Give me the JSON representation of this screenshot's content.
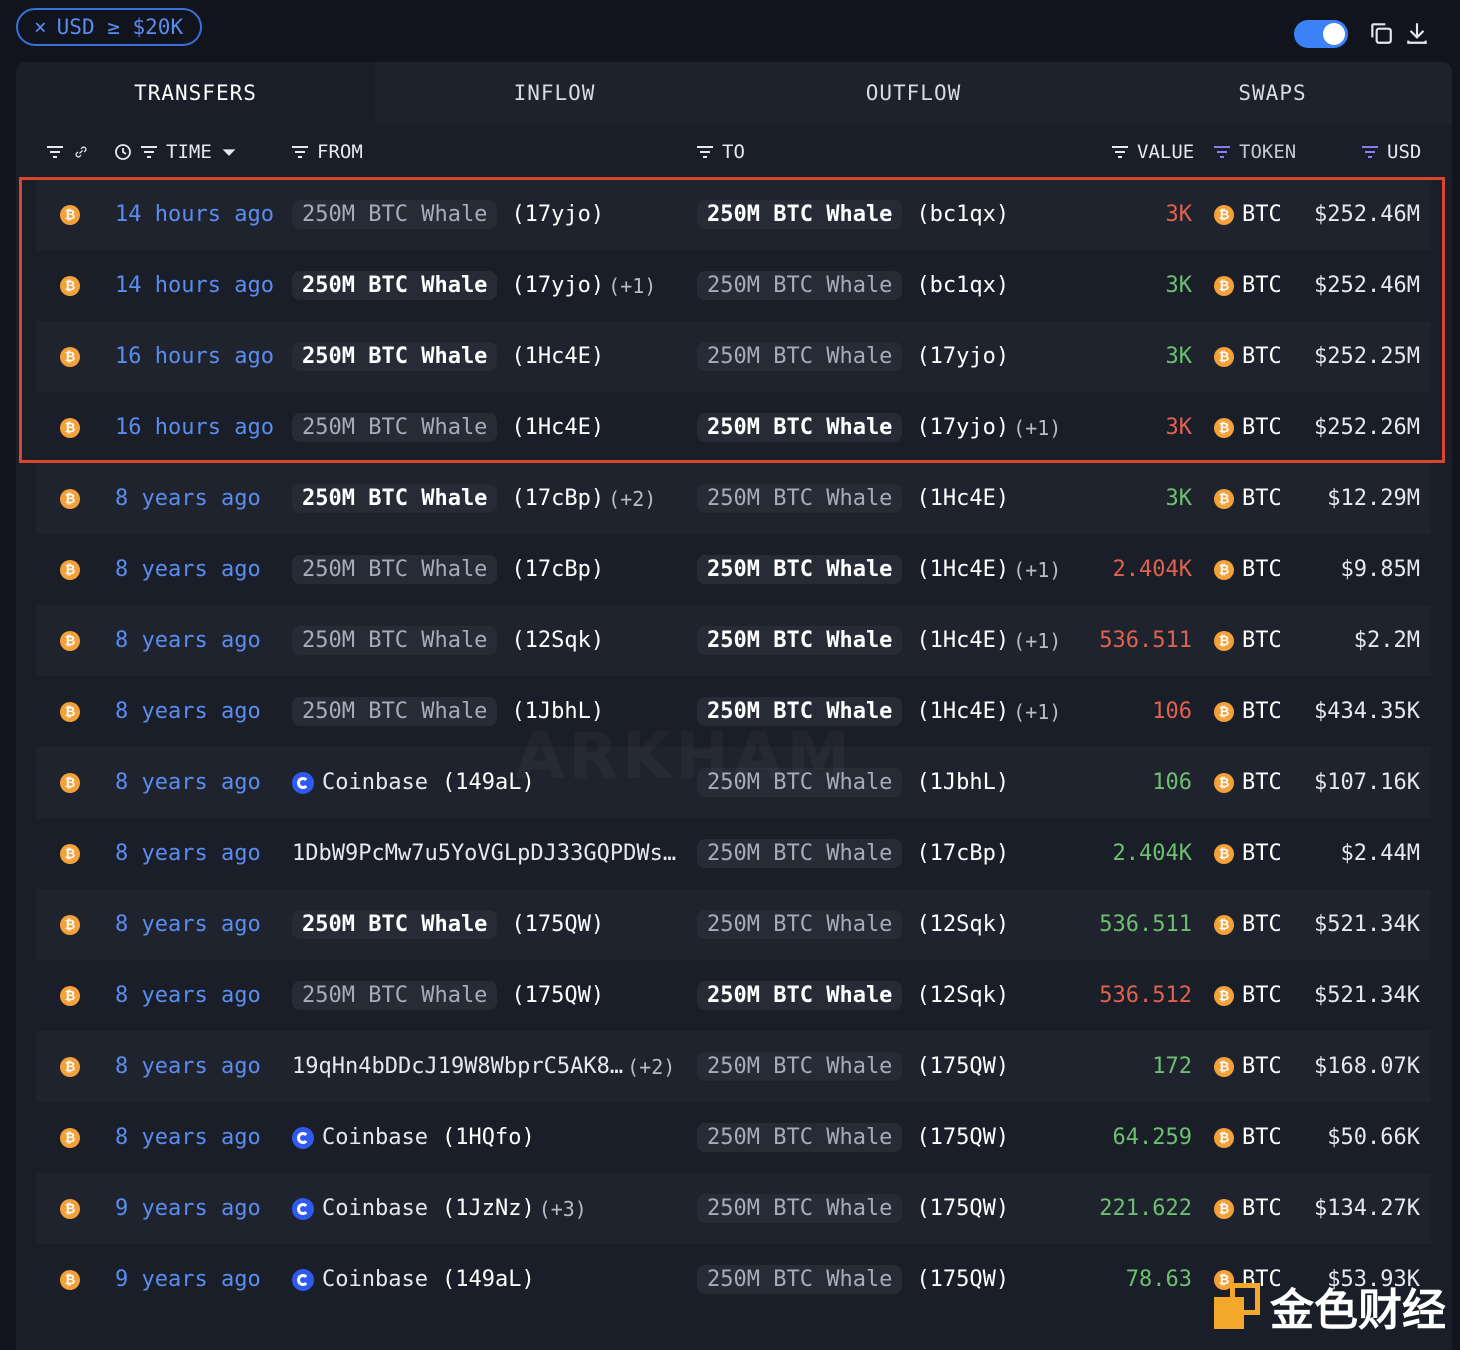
{
  "filter": {
    "close_glyph": "×",
    "label": "USD ≥ $20K"
  },
  "colors": {
    "accent": "#3b6fd8",
    "positive": "#6cc070",
    "negative": "#e0624f",
    "btc": "#f4a13a",
    "highlight": "#d9452f"
  },
  "tabs": [
    {
      "label": "TRANSFERS",
      "active": true
    },
    {
      "label": "INFLOW",
      "active": false
    },
    {
      "label": "OUTFLOW",
      "active": false
    },
    {
      "label": "SWAPS",
      "active": false
    }
  ],
  "columns": {
    "time": "TIME",
    "from": "FROM",
    "to": "TO",
    "value": "VALUE",
    "token": "TOKEN",
    "usd": "USD"
  },
  "icons": {
    "btc": "₿",
    "filter": "filter-icon",
    "link": "link-icon",
    "clock": "clock-icon",
    "copy": "copy-icon",
    "download": "download-icon"
  },
  "rows": [
    {
      "time": "14 hours ago",
      "from": {
        "type": "entity",
        "name": "250M BTC Whale",
        "addr": "(17yjo)",
        "extra": "",
        "style": "dim"
      },
      "to": {
        "name": "250M BTC Whale",
        "addr": "(bc1qx)",
        "extra": "",
        "style": "bright"
      },
      "value": "3K",
      "dir": "out",
      "token": "BTC",
      "usd": "$252.46M"
    },
    {
      "time": "14 hours ago",
      "from": {
        "type": "entity",
        "name": "250M BTC Whale",
        "addr": "(17yjo)",
        "extra": "(+1)",
        "style": "bright"
      },
      "to": {
        "name": "250M BTC Whale",
        "addr": "(bc1qx)",
        "extra": "",
        "style": "dim"
      },
      "value": "3K",
      "dir": "in",
      "token": "BTC",
      "usd": "$252.46M"
    },
    {
      "time": "16 hours ago",
      "from": {
        "type": "entity",
        "name": "250M BTC Whale",
        "addr": "(1Hc4E)",
        "extra": "",
        "style": "bright"
      },
      "to": {
        "name": "250M BTC Whale",
        "addr": "(17yjo)",
        "extra": "",
        "style": "dim"
      },
      "value": "3K",
      "dir": "in",
      "token": "BTC",
      "usd": "$252.25M"
    },
    {
      "time": "16 hours ago",
      "from": {
        "type": "entity",
        "name": "250M BTC Whale",
        "addr": "(1Hc4E)",
        "extra": "",
        "style": "dim"
      },
      "to": {
        "name": "250M BTC Whale",
        "addr": "(17yjo)",
        "extra": "(+1)",
        "style": "bright"
      },
      "value": "3K",
      "dir": "out",
      "token": "BTC",
      "usd": "$252.26M"
    },
    {
      "time": "8 years ago",
      "from": {
        "type": "entity",
        "name": "250M BTC Whale",
        "addr": "(17cBp)",
        "extra": "(+2)",
        "style": "bright"
      },
      "to": {
        "name": "250M BTC Whale",
        "addr": "(1Hc4E)",
        "extra": "",
        "style": "dim"
      },
      "value": "3K",
      "dir": "in",
      "token": "BTC",
      "usd": "$12.29M"
    },
    {
      "time": "8 years ago",
      "from": {
        "type": "entity",
        "name": "250M BTC Whale",
        "addr": "(17cBp)",
        "extra": "",
        "style": "dim"
      },
      "to": {
        "name": "250M BTC Whale",
        "addr": "(1Hc4E)",
        "extra": "(+1)",
        "style": "bright"
      },
      "value": "2.404K",
      "dir": "out",
      "token": "BTC",
      "usd": "$9.85M"
    },
    {
      "time": "8 years ago",
      "from": {
        "type": "entity",
        "name": "250M BTC Whale",
        "addr": "(12Sqk)",
        "extra": "",
        "style": "dim"
      },
      "to": {
        "name": "250M BTC Whale",
        "addr": "(1Hc4E)",
        "extra": "(+1)",
        "style": "bright"
      },
      "value": "536.511",
      "dir": "out",
      "token": "BTC",
      "usd": "$2.2M"
    },
    {
      "time": "8 years ago",
      "from": {
        "type": "entity",
        "name": "250M BTC Whale",
        "addr": "(1JbhL)",
        "extra": "",
        "style": "dim"
      },
      "to": {
        "name": "250M BTC Whale",
        "addr": "(1Hc4E)",
        "extra": "(+1)",
        "style": "bright"
      },
      "value": "106",
      "dir": "out",
      "token": "BTC",
      "usd": "$434.35K"
    },
    {
      "time": "8 years ago",
      "from": {
        "type": "coinbase",
        "name": "Coinbase",
        "addr": "(149aL)",
        "extra": "",
        "style": "plain"
      },
      "to": {
        "name": "250M BTC Whale",
        "addr": "(1JbhL)",
        "extra": "",
        "style": "dim"
      },
      "value": "106",
      "dir": "in",
      "token": "BTC",
      "usd": "$107.16K"
    },
    {
      "time": "8 years ago",
      "from": {
        "type": "raw",
        "name": "1DbW9PcMw7u5YoVGLpDJ33GQPDWs…",
        "addr": "",
        "extra": "",
        "style": "plain"
      },
      "to": {
        "name": "250M BTC Whale",
        "addr": "(17cBp)",
        "extra": "",
        "style": "dim"
      },
      "value": "2.404K",
      "dir": "in",
      "token": "BTC",
      "usd": "$2.44M"
    },
    {
      "time": "8 years ago",
      "from": {
        "type": "entity",
        "name": "250M BTC Whale",
        "addr": "(175QW)",
        "extra": "",
        "style": "bright"
      },
      "to": {
        "name": "250M BTC Whale",
        "addr": "(12Sqk)",
        "extra": "",
        "style": "dim"
      },
      "value": "536.511",
      "dir": "in",
      "token": "BTC",
      "usd": "$521.34K"
    },
    {
      "time": "8 years ago",
      "from": {
        "type": "entity",
        "name": "250M BTC Whale",
        "addr": "(175QW)",
        "extra": "",
        "style": "dim"
      },
      "to": {
        "name": "250M BTC Whale",
        "addr": "(12Sqk)",
        "extra": "",
        "style": "bright"
      },
      "value": "536.512",
      "dir": "out",
      "token": "BTC",
      "usd": "$521.34K"
    },
    {
      "time": "8 years ago",
      "from": {
        "type": "raw",
        "name": "19qHn4bDDcJ19W8WbprC5AK8…",
        "addr": "",
        "extra": "(+2)",
        "style": "plain"
      },
      "to": {
        "name": "250M BTC Whale",
        "addr": "(175QW)",
        "extra": "",
        "style": "dim"
      },
      "value": "172",
      "dir": "in",
      "token": "BTC",
      "usd": "$168.07K"
    },
    {
      "time": "8 years ago",
      "from": {
        "type": "coinbase",
        "name": "Coinbase",
        "addr": "(1HQfo)",
        "extra": "",
        "style": "plain"
      },
      "to": {
        "name": "250M BTC Whale",
        "addr": "(175QW)",
        "extra": "",
        "style": "dim"
      },
      "value": "64.259",
      "dir": "in",
      "token": "BTC",
      "usd": "$50.66K"
    },
    {
      "time": "9 years ago",
      "from": {
        "type": "coinbase",
        "name": "Coinbase",
        "addr": "(1JzNz)",
        "extra": "(+3)",
        "style": "plain"
      },
      "to": {
        "name": "250M BTC Whale",
        "addr": "(175QW)",
        "extra": "",
        "style": "dim"
      },
      "value": "221.622",
      "dir": "in",
      "token": "BTC",
      "usd": "$134.27K"
    },
    {
      "time": "9 years ago",
      "from": {
        "type": "coinbase",
        "name": "Coinbase",
        "addr": "(149aL)",
        "extra": "",
        "style": "plain"
      },
      "to": {
        "name": "250M BTC Whale",
        "addr": "(175QW)",
        "extra": "",
        "style": "dim"
      },
      "value": "78.63",
      "dir": "in",
      "token": "BTC",
      "usd": "$53.93K"
    }
  ],
  "watermark": "ARKHAM",
  "brand": {
    "text": "金色财经"
  }
}
